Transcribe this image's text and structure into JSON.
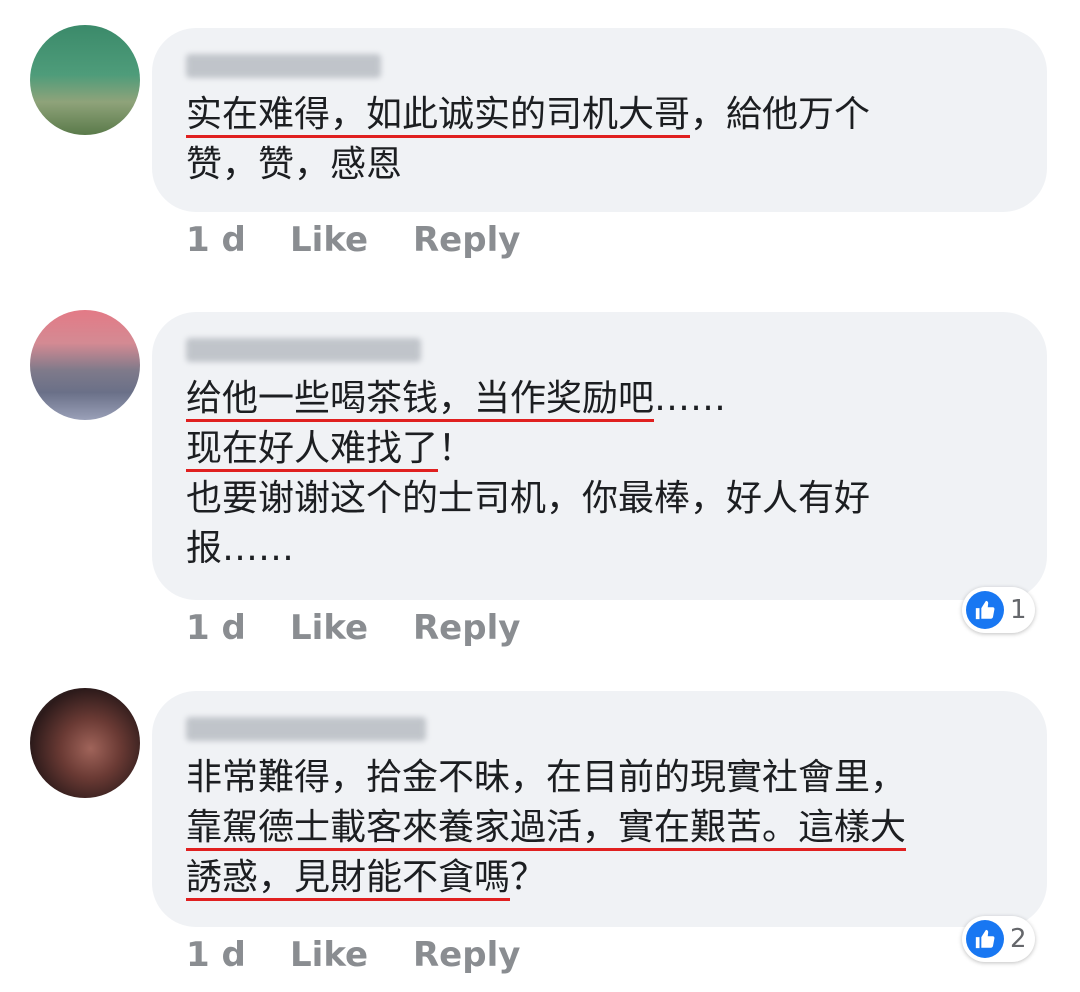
{
  "comments": [
    {
      "lines": [
        {
          "text": "实在难得，如此诚实的司机大哥",
          "underline": true
        },
        {
          "text": "，給他万个",
          "underline": false
        },
        {
          "text": "赞，赞，感恩",
          "underline": false
        }
      ],
      "time": "1 d",
      "like_label": "Like",
      "reply_label": "Reply"
    },
    {
      "lines": [
        {
          "text": "给他一些喝茶钱，当作奖励吧",
          "underline": true
        },
        {
          "text": "……",
          "underline": false
        },
        {
          "text": "现在好人难找了",
          "underline": true
        },
        {
          "text": "！",
          "underline": false
        },
        {
          "text": "也要谢谢这个的士司机，你最棒，好人有好",
          "underline": false
        },
        {
          "text": "报……",
          "underline": false
        }
      ],
      "time": "1 d",
      "like_label": "Like",
      "reply_label": "Reply",
      "reaction_count": "1"
    },
    {
      "lines": [
        {
          "text": "非常難得，拾金不昧，在目前的現實社會里，",
          "underline": false
        },
        {
          "text": "靠駕德士載客來養家過活，實在艱苦。這樣大",
          "underline": true
        },
        {
          "text": "誘惑，見財能不貪嗎",
          "underline": true
        },
        {
          "text": "？",
          "underline": false
        }
      ],
      "time": "1 d",
      "like_label": "Like",
      "reply_label": "Reply",
      "reaction_count": "2"
    }
  ],
  "colors": {
    "bubble": "#f0f2f5",
    "underline": "#e02020",
    "like_blue": "#1877f2"
  }
}
